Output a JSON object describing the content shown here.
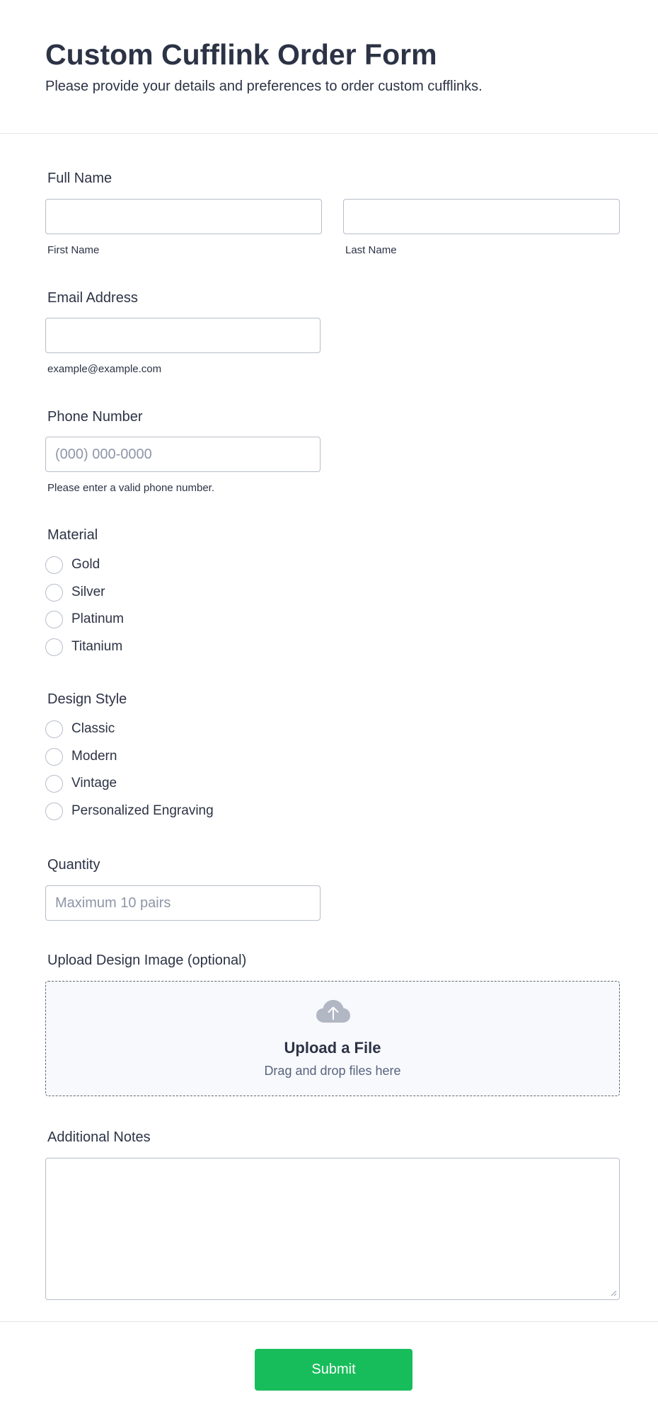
{
  "header": {
    "title": "Custom Cufflink Order Form",
    "subtitle": "Please provide your details and preferences to order custom cufflinks."
  },
  "full_name": {
    "label": "Full Name",
    "first_value": "",
    "first_sublabel": "First Name",
    "last_value": "",
    "last_sublabel": "Last Name"
  },
  "email": {
    "label": "Email Address",
    "value": "",
    "sublabel": "example@example.com"
  },
  "phone": {
    "label": "Phone Number",
    "placeholder": "(000) 000-0000",
    "sublabel": "Please enter a valid phone number."
  },
  "material": {
    "label": "Material",
    "options": [
      "Gold",
      "Silver",
      "Platinum",
      "Titanium"
    ]
  },
  "design_style": {
    "label": "Design Style",
    "options": [
      "Classic",
      "Modern",
      "Vintage",
      "Personalized Engraving"
    ]
  },
  "quantity": {
    "label": "Quantity",
    "placeholder": "Maximum 10 pairs"
  },
  "upload": {
    "label": "Upload Design Image (optional)",
    "title": "Upload a File",
    "hint": "Drag and drop files here",
    "icon": "cloud-upload-icon"
  },
  "notes": {
    "label": "Additional Notes",
    "value": ""
  },
  "footer": {
    "submit_label": "Submit"
  },
  "colors": {
    "text": "#2c3345",
    "border": "#b8bdc9",
    "submit": "#18bd5b",
    "upload_bg": "#f8f9fc",
    "placeholder": "#8d96a8"
  }
}
